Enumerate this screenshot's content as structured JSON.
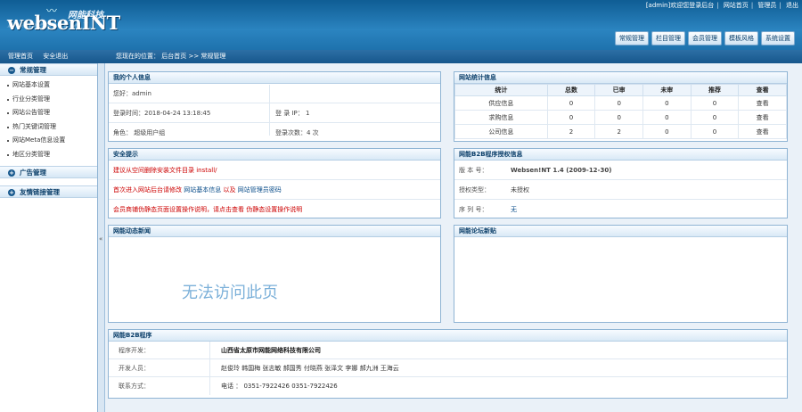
{
  "header": {
    "logo_text": "websenINT",
    "logo_cn": "网能科技",
    "top_links": [
      "[admin]欢迎您登录后台",
      "网站首页",
      "管理员",
      "退出"
    ],
    "nav": [
      "常规管理",
      "栏目管理",
      "会员管理",
      "模板风格",
      "系统设置"
    ]
  },
  "subbar": {
    "left_links": [
      "管理首页",
      "安全退出"
    ],
    "breadcrumb": "您现在的位置：  后台首页  >>  常规管理"
  },
  "sidebar": {
    "sections": [
      {
        "title": "常规管理",
        "icon": "minus-circle-icon",
        "items": [
          "网站基本设置",
          "行业分类管理",
          "网站公告管理",
          "热门关键词管理",
          "网站Meta信息设置",
          "地区分类管理"
        ]
      },
      {
        "title": "广告管理",
        "icon": "plus-circle-icon",
        "items": []
      },
      {
        "title": "友情链接管理",
        "icon": "plus-circle-icon",
        "items": []
      }
    ],
    "splitter_glyph": "«"
  },
  "myinfo": {
    "title": "我的个人信息",
    "greeting": "您好：admin",
    "login_time": "登录时间：2018-04-24 13:18:45",
    "login_ip": "登 录 IP：  1",
    "role": "角色：  超级用户组",
    "login_count": "登录次数：4 次"
  },
  "security": {
    "title": "安全提示",
    "line1": "建议从空间删除安装文件目录 install/",
    "line2_prefix": "首次进入网站后台请修改",
    "line2_link1": "网站基本信息",
    "line2_mid": "以及",
    "line2_link2": "网站管理员密码",
    "line3_a": "会员商铺伪静态页面设置操作说明，请点击查看",
    "line3_b": "伪静态设置操作说明"
  },
  "stats": {
    "title": "网站统计信息",
    "columns": [
      "统计",
      "总数",
      "已审",
      "未审",
      "推荐",
      "查看"
    ],
    "rows": [
      [
        "供应信息",
        "0",
        "0",
        "0",
        "0",
        "查看"
      ],
      [
        "求购信息",
        "0",
        "0",
        "0",
        "0",
        "查看"
      ],
      [
        "公司信息",
        "2",
        "2",
        "0",
        "0",
        "查看"
      ]
    ]
  },
  "license": {
    "title": "网能B2B程序授权信息",
    "version_label": "版 本 号：",
    "version_value": "Websen!NT 1.4 (2009-12-30)",
    "type_label": "授权类型：",
    "type_value": "未授权",
    "serial_label": "序 列 号：",
    "serial_value": "无"
  },
  "news": {
    "title": "网能动态新闻",
    "message": "无法访问此页"
  },
  "forum": {
    "title": "网能论坛新贴"
  },
  "program": {
    "title": "网能B2B程序",
    "dev_label": "程序开发：",
    "dev_value": "山西省太原市网能网络科技有限公司",
    "people_label": "开发人员：",
    "people_value": "赵俊玲  韩国梅  张志敏  郝国秀  付晓燕  张泽文  李娜  郝九洲  王海云",
    "contact_label": "联系方式：",
    "contact_value": "电话 ： 0351-7922426  0351-7922426"
  }
}
